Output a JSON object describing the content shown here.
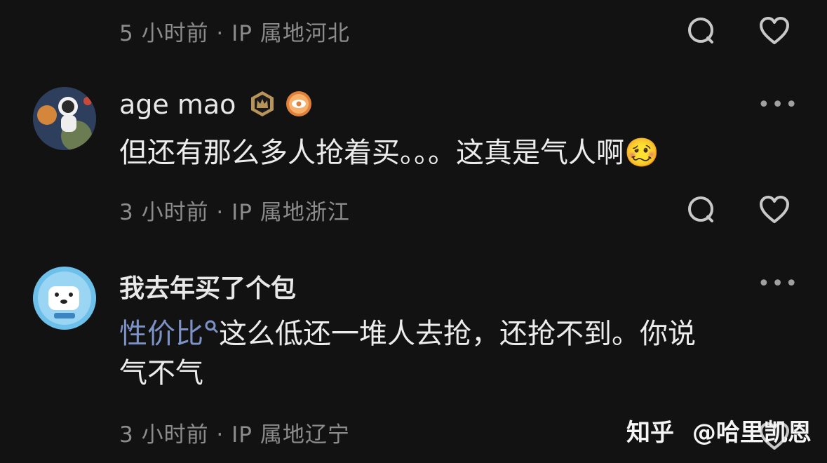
{
  "comments": [
    {
      "meta": "5 小时前 · IP 属地河北"
    },
    {
      "username": "age mao",
      "text": "但还有那么多人抢着买。。。这真是气人啊",
      "emoji": "🥴",
      "meta": "3 小时前 · IP 属地浙江",
      "more": "•••"
    },
    {
      "username": "我去年买了个包",
      "link_text": "性价比",
      "text_line1": "这么低还一堆人去抢，还抢不到。你说",
      "text_line2": "气不气",
      "meta": "3 小时前 · IP 属地辽宁",
      "more": "•••"
    }
  ],
  "watermark": {
    "brand": "知乎",
    "author": "@哈里凯恩"
  },
  "icons": {
    "reply": "reply-bubble-icon",
    "like": "heart-icon",
    "search": "search-icon"
  },
  "colors": {
    "background": "#121212",
    "link": "#7d93c8",
    "meta": "#8c8c8c"
  }
}
